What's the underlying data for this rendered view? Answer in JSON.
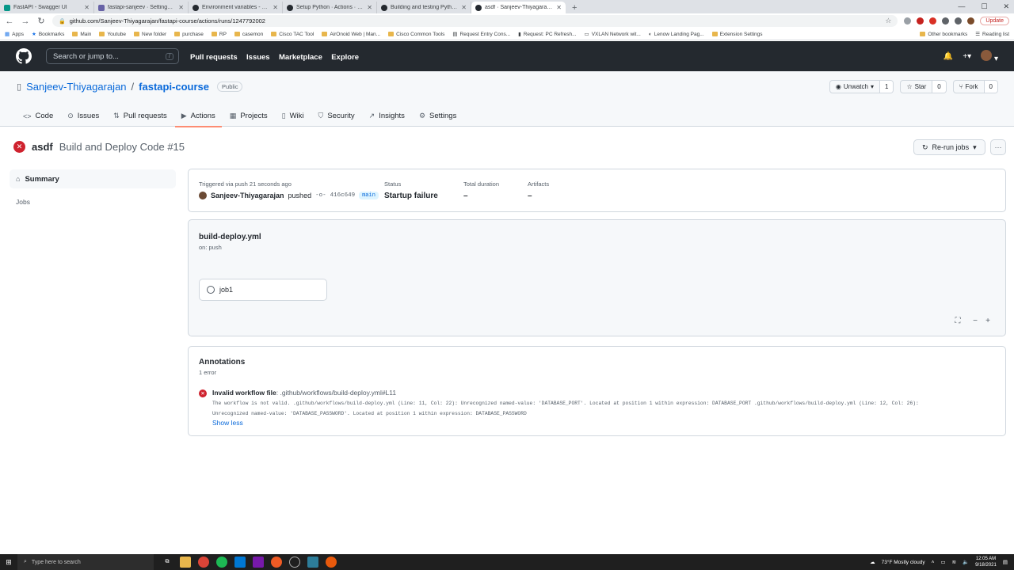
{
  "browser": {
    "tabs": [
      {
        "label": "FastAPI - Swagger UI",
        "color": "#049688"
      },
      {
        "label": "fastapi-sanjeev · Settings | Herok",
        "color": "#6762a6"
      },
      {
        "label": "Environment variables - GitHub",
        "color": "#24292f"
      },
      {
        "label": "Setup Python · Actions · GitHub",
        "color": "#24292f"
      },
      {
        "label": "Building and testing Python - Gi",
        "color": "#24292f"
      },
      {
        "label": "asdf · Sanjeev-Thiyagarajan/faste",
        "color": "#24292f",
        "active": true
      }
    ],
    "new_tab": "+",
    "url": "github.com/Sanjeev-Thiyagarajan/fastapi-course/actions/runs/1247792002",
    "update_label": "Update",
    "bookmarks": [
      "Apps",
      "Bookmarks",
      "Main",
      "Youtube",
      "New folder",
      "purchase",
      "RP",
      "casemon",
      "Cisco TAC Tool",
      "AirOnoid Web | Man...",
      "Cisco Common Tools",
      "Request Entry Cons...",
      "Request: PC Refresh...",
      "VXLAN Network wit...",
      "Lenow Landing Pag...",
      "Extension Settings"
    ],
    "bookmarks_right": [
      "Other bookmarks",
      "Reading list"
    ]
  },
  "github": {
    "search_placeholder": "Search or jump to...",
    "search_key": "/",
    "nav": [
      "Pull requests",
      "Issues",
      "Marketplace",
      "Explore"
    ]
  },
  "repo": {
    "owner": "Sanjeev-Thiyagarajan",
    "separator": "/",
    "name": "fastapi-course",
    "visibility": "Public",
    "unwatch_label": "Unwatch",
    "unwatch_count": "1",
    "star_label": "Star",
    "star_count": "0",
    "fork_label": "Fork",
    "fork_count": "0",
    "tabs": [
      {
        "label": "Code",
        "icon": "<>"
      },
      {
        "label": "Issues",
        "icon": "⊙"
      },
      {
        "label": "Pull requests",
        "icon": "⇅"
      },
      {
        "label": "Actions",
        "icon": "▶",
        "active": true
      },
      {
        "label": "Projects",
        "icon": "▦"
      },
      {
        "label": "Wiki",
        "icon": "▯"
      },
      {
        "label": "Security",
        "icon": "⛉"
      },
      {
        "label": "Insights",
        "icon": "↗"
      },
      {
        "label": "Settings",
        "icon": "⚙"
      }
    ]
  },
  "run": {
    "commit_message": "asdf",
    "workflow": "Build and Deploy Code #15",
    "rerun_label": "Re-run jobs",
    "sidebar_summary": "Summary",
    "sidebar_jobs": "Jobs",
    "triggered": "Triggered via push 21 seconds ago",
    "user": "Sanjeev-Thiyagarajan",
    "pushed": "pushed",
    "sha": "416c649",
    "branch": "main",
    "status_label": "Status",
    "status_value": "Startup failure",
    "duration_label": "Total duration",
    "duration_value": "–",
    "artifacts_label": "Artifacts",
    "artifacts_value": "–"
  },
  "graph": {
    "file": "build-deploy.yml",
    "trigger": "on: push",
    "job": "job1"
  },
  "annotations": {
    "title": "Annotations",
    "count": "1 error",
    "error_title": "Invalid workflow file",
    "error_path": ": .github/workflows/build-deploy.yml#L11",
    "message_line1": "The workflow is not valid. .github/workflows/build-deploy.yml (Line: 11, Col: 22): Unrecognized named-value: 'DATABASE_PORT'. Located at position 1 within expression: DATABASE_PORT .github/workflows/build-deploy.yml (Line: 12, Col: 26):",
    "message_line2": "Unrecognized named-value: 'DATABASE_PASSWORD'. Located at position 1 within expression: DATABASE_PASSWORD",
    "show_less": "Show less"
  },
  "taskbar": {
    "search_placeholder": "Type here to search",
    "weather": "73°F  Mostly cloudy",
    "time": "12:05 AM",
    "date": "9/18/2021"
  }
}
